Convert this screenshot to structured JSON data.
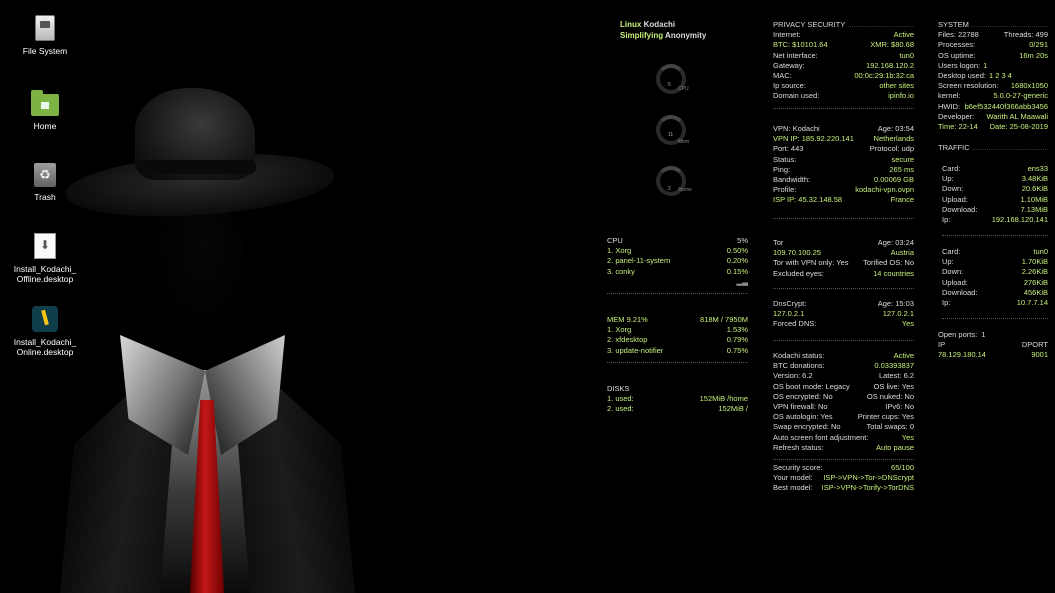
{
  "desktop": {
    "icons": [
      {
        "label": "File System",
        "icon": "file-system-icon"
      },
      {
        "label": "Home",
        "icon": "home-folder-icon"
      },
      {
        "label": "Trash",
        "icon": "trash-icon"
      },
      {
        "label": "Install_Kodachi_\nOffline.desktop",
        "icon": "download-file-icon"
      },
      {
        "label": "Install_Kodachi_\nOnline.desktop",
        "icon": "kodachi-installer-icon"
      }
    ]
  },
  "brand": {
    "line1_a": "Linux ",
    "line1_b": "Kodachi",
    "line2_a": "Simplifying ",
    "line2_b": "Anonymity"
  },
  "gauges": [
    {
      "label": "CPU",
      "small": "5"
    },
    {
      "label": "Mem",
      "small": "11"
    },
    {
      "label": "/home",
      "small": "2"
    }
  ],
  "cpu": {
    "title": "CPU",
    "percent": "5%",
    "rows": [
      {
        "name": "1. Xorg",
        "value": "0.50%"
      },
      {
        "name": "2. panel-11-system",
        "value": "0.20%"
      },
      {
        "name": "3. conky",
        "value": "0.15%"
      }
    ]
  },
  "mem": {
    "title": "MEM 9.21%",
    "usage": "818M / 7950M",
    "rows": [
      {
        "name": "1. Xorg",
        "value": "1.53%"
      },
      {
        "name": "2. xfdesktop",
        "value": "0.79%"
      },
      {
        "name": "3. update-notifier",
        "value": "0.75%"
      }
    ]
  },
  "disks": {
    "title": "DISKS",
    "rows": [
      {
        "name": "1. used:",
        "value": "152MiB /home"
      },
      {
        "name": "2. used:",
        "value": "152MiB /"
      }
    ]
  },
  "privacy": {
    "title": "PRIVACY SECURITY",
    "internet": {
      "k": "Internet:",
      "v": "Active"
    },
    "btc": "BTC: $10101.64",
    "xmr": "XMR: $80.68",
    "net_interface": {
      "k": "Net interface:",
      "v": "tun0"
    },
    "gateway": {
      "k": "Gateway:",
      "v": "192.168.120.2"
    },
    "mac": {
      "k": "MAC:",
      "v": "00:0c:29:1b:32:ca"
    },
    "ip_source": {
      "k": "Ip source:",
      "v": "other sites"
    },
    "domain": {
      "k": "Domain used:",
      "v": "ipinfo.io"
    }
  },
  "vpn": {
    "name": "VPN: Kodachi",
    "age": "Age: 03:54",
    "ip": "VPN IP: 185.92.220.141",
    "country": "Netherlands",
    "port": "Port: 443",
    "protocol": "Protocol: udp",
    "status": {
      "k": "Status:",
      "v": "secure"
    },
    "ping": {
      "k": "Ping:",
      "v": "265 ms"
    },
    "bandwidth": {
      "k": "Bandwidth:",
      "v": "0.00069 GB"
    },
    "profile": {
      "k": "Profile:",
      "v": "kodachi-vpn.ovpn"
    },
    "isp": "ISP IP: 45.32.148.58",
    "isp_country": "France"
  },
  "tor": {
    "title": "Tor",
    "age": "Age: 03:24",
    "ip": "109.70.100.25",
    "country": "Austria",
    "with_vpn": "Tor with VPN only: Yes",
    "torified": "Torified OS: No",
    "excluded": {
      "k": "Excluded eyes:",
      "v": "14 countries"
    }
  },
  "dnscrypt": {
    "title": "DnsCrypt:",
    "age": "Age: 15:03",
    "ip": "127.0.2.1",
    "ip2": "127.0.2.1",
    "forced": {
      "k": "Forced DNS:",
      "v": "Yes"
    }
  },
  "kodachi": {
    "status": {
      "k": "Kodachi status:",
      "v": "Active"
    },
    "donations": {
      "k": "BTC donations:",
      "v": "0.03393837"
    },
    "version": "Version: 6.2",
    "latest": "Latest: 6.2",
    "boot_mode": "OS boot mode: Legacy",
    "os_live": "OS live: Yes",
    "encrypted": "OS encrypted: No",
    "nuked": "OS nuked: No",
    "firewall": "VPN firewall: No",
    "ipv6": "IPv6: No",
    "autologin": "OS autologin: Yes",
    "printer": "Printer cups: Yes",
    "swap_enc": "Swap encrypted: No",
    "total_swaps": "Total swaps: 0",
    "font_adj": {
      "k": "Auto screen font adjustment:",
      "v": "Yes"
    },
    "refresh": {
      "k": "Refresh status:",
      "v": "Auto pause"
    }
  },
  "security": {
    "score": {
      "k": "Security score:",
      "v": "65/100"
    },
    "your_model": {
      "k": "Your model:",
      "v": "ISP->VPN->Tor->DNScrypt"
    },
    "best_model": {
      "k": "Best model:",
      "v": "ISP->VPN->Torify->TorDNS"
    }
  },
  "system": {
    "title": "SYSTEM",
    "files": "Files: 22788",
    "threads": "Threads: 499",
    "processes": {
      "k": "Processes:",
      "v": "0/291"
    },
    "uptime": {
      "k": "OS uptime:",
      "v": "16m 20s"
    },
    "users": {
      "k": "Users logon:",
      "v": "1"
    },
    "desktop_used": {
      "k": "Desktop used:",
      "v": "1 2 3 4"
    },
    "resolution": {
      "k": "Screen resolution:",
      "v": "1680x1050"
    },
    "kernel": {
      "k": "kernel:",
      "v": "5.0.0-27-generic"
    },
    "hwid": {
      "k": "HWID:",
      "v": "b6ef532440f366abb3456"
    },
    "developer": {
      "k": "Developer:",
      "v": "Warith AL Maawali"
    },
    "time": "Time: 22-14",
    "date": "Date: 25-08-2019"
  },
  "traffic": {
    "title": "TRAFFIC",
    "cards": [
      {
        "card": "ens33",
        "up": "3.48KiB",
        "down": "20.6KiB",
        "upload": "1.10MiB",
        "download": "7.13MiB",
        "ip": "192.168.120.141"
      },
      {
        "card": "tun0",
        "up": "1.70KiB",
        "down": "2.26KiB",
        "upload": "276KiB",
        "download": "456KiB",
        "ip": "10.7.7.14"
      }
    ],
    "labels": {
      "card": "Card:",
      "up": "Up:",
      "down": "Down:",
      "upload": "Upload:",
      "download": "Download:",
      "ip": "Ip:"
    }
  },
  "ports": {
    "title": "Open ports:",
    "count": "1",
    "col_ip": "IP",
    "col_port": "DPORT",
    "ip": "78.129.180.14",
    "port": "9001"
  }
}
